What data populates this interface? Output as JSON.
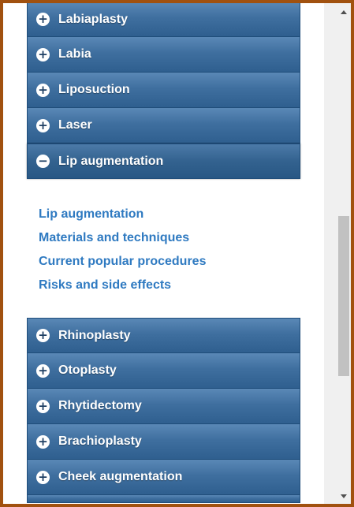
{
  "accordion_top": {
    "items": [
      {
        "label": "Labiaplasty",
        "sign": "+"
      },
      {
        "label": "Labia",
        "sign": "+"
      },
      {
        "label": "Liposuction",
        "sign": "+"
      },
      {
        "label": "Laser",
        "sign": "+"
      },
      {
        "label": "Lip augmentation",
        "sign": "−"
      }
    ]
  },
  "sublinks": [
    "Lip augmentation",
    "Materials and techniques",
    "Current popular procedures",
    "Risks and side effects"
  ],
  "accordion_bottom": {
    "items": [
      {
        "label": "Rhinoplasty",
        "sign": "+"
      },
      {
        "label": "Otoplasty",
        "sign": "+"
      },
      {
        "label": "Rhytidectomy",
        "sign": "+"
      },
      {
        "label": "Brachioplasty",
        "sign": "+"
      },
      {
        "label": "Cheek augmentation",
        "sign": "+"
      }
    ]
  },
  "colors": {
    "frame": "#a1510f",
    "header_gradient_top": "#5a88b6",
    "header_gradient_bottom": "#2f5f8f",
    "link": "#2f7ac1"
  }
}
